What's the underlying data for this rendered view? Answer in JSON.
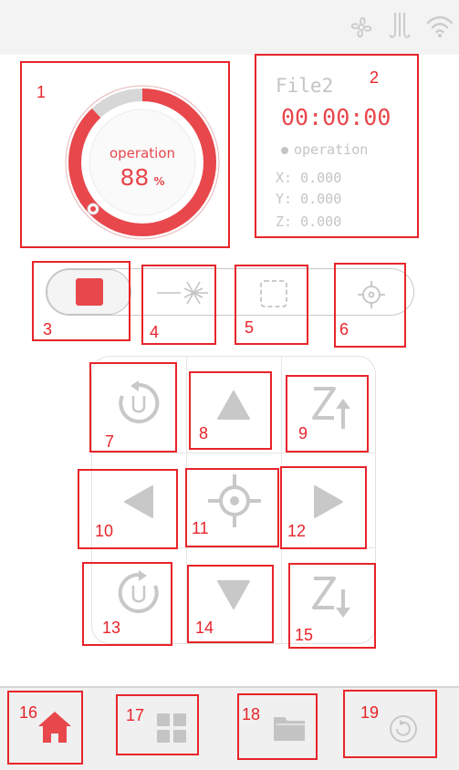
{
  "status": {
    "progress_percent": 88,
    "operation_label": "operation",
    "progress_value": "88",
    "percent_sign": "%"
  },
  "file_panel": {
    "file_name": "File2",
    "timer": "00:00:00",
    "state": "operation",
    "x": "X: 0.000",
    "y": "Y: 0.000",
    "z": "Z: 0.000"
  },
  "annotations": [
    "1",
    "2",
    "3",
    "4",
    "5",
    "6",
    "7",
    "8",
    "9",
    "10",
    "11",
    "12",
    "13",
    "14",
    "15",
    "16",
    "17",
    "18",
    "19"
  ],
  "colors": {
    "accent": "#e8474c",
    "icon_gray": "#c8c8c8",
    "annotation_red": "#e8242a"
  },
  "icons": {
    "top_bar": [
      "fan-icon",
      "air-assist-icon",
      "wifi-icon"
    ],
    "controls": [
      "stop-icon",
      "laser-icon",
      "frame-icon",
      "crosshair-icon"
    ],
    "jog": [
      "rotate-ccw-icon",
      "arrow-up-icon",
      "z-up-icon",
      "arrow-left-icon",
      "home-crosshair-icon",
      "arrow-right-icon",
      "rotate-cw-icon",
      "arrow-down-icon",
      "z-down-icon"
    ],
    "nav": [
      "home-icon",
      "apps-icon",
      "folder-icon",
      "refresh-icon"
    ]
  }
}
